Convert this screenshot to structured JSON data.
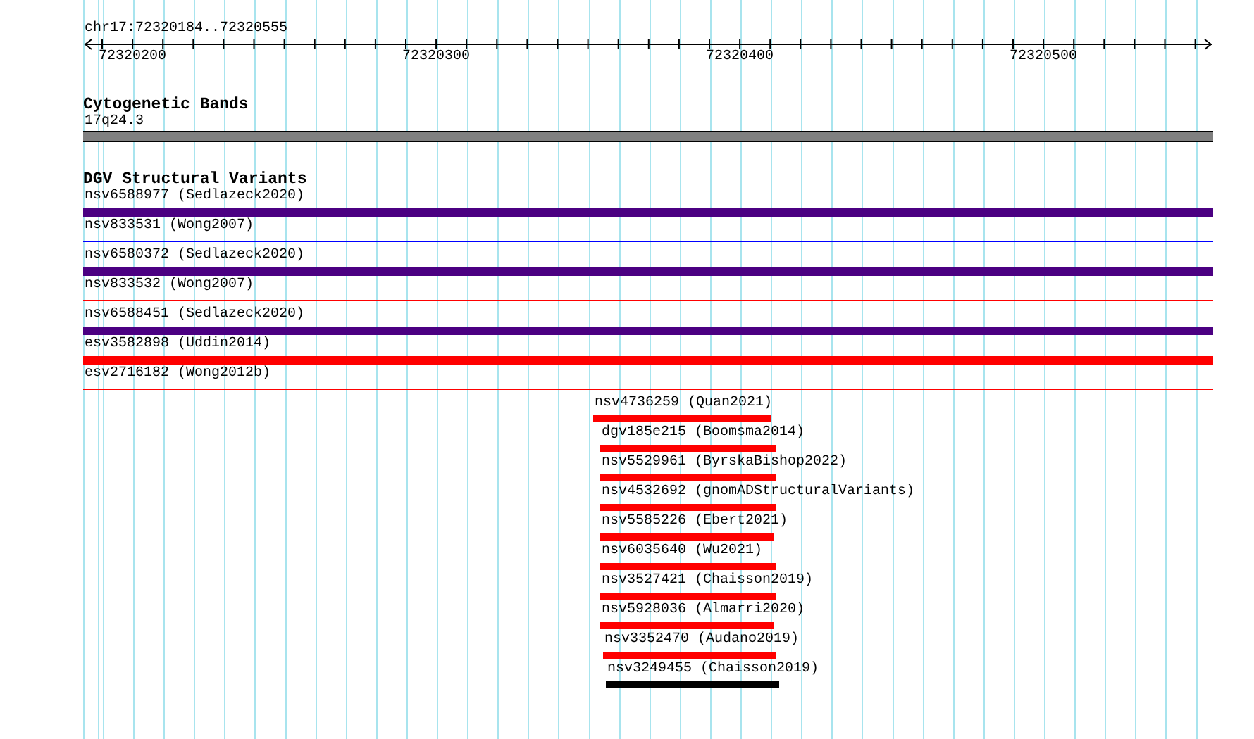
{
  "ruler": {
    "title": "chr17:72320184..72320555",
    "ticks": [
      "72320200",
      "72320300",
      "72320400",
      "72320500"
    ]
  },
  "cytogenetic_track": {
    "title": "Cytogenetic Bands",
    "band": {
      "label": "17q24.3",
      "color": "#808080"
    }
  },
  "dgv_track": {
    "title": "DGV Structural Variants",
    "variants": [
      {
        "label": "nsv6588977 (Sedlazeck2020)",
        "kind": "bar",
        "color": "#4b0082"
      },
      {
        "label": "nsv833531 (Wong2007)",
        "kind": "line",
        "color": "#0000ff"
      },
      {
        "label": "nsv6580372 (Sedlazeck2020)",
        "kind": "bar",
        "color": "#4b0082"
      },
      {
        "label": "nsv833532 (Wong2007)",
        "kind": "line",
        "color": "#ff0000"
      },
      {
        "label": "nsv6588451 (Sedlazeck2020)",
        "kind": "bar",
        "color": "#4b0082"
      },
      {
        "label": "esv3582898 (Uddin2014)",
        "kind": "bar",
        "color": "#ff0000"
      },
      {
        "label": "esv2716182 (Wong2012b)",
        "kind": "line",
        "color": "#ff0000"
      }
    ],
    "short_variants": [
      {
        "label": "nsv4736259 (Quan2021)",
        "kind": "bar",
        "color": "#ff0000"
      },
      {
        "label": "dgv185e215 (Boomsma2014)",
        "kind": "bar",
        "color": "#ff0000"
      },
      {
        "label": "nsv5529961 (ByrskaBishop2022)",
        "kind": "bar",
        "color": "#ff0000"
      },
      {
        "label": "nsv4532692 (gnomADStructuralVariants)",
        "kind": "bar",
        "color": "#ff0000"
      },
      {
        "label": "nsv5585226 (Ebert2021)",
        "kind": "bar",
        "color": "#ff0000"
      },
      {
        "label": "nsv6035640 (Wu2021)",
        "kind": "bar",
        "color": "#ff0000"
      },
      {
        "label": "nsv3527421 (Chaisson2019)",
        "kind": "bar",
        "color": "#ff0000"
      },
      {
        "label": "nsv5928036 (Almarri2020)",
        "kind": "bar",
        "color": "#ff0000"
      },
      {
        "label": "nsv3352470 (Audano2019)",
        "kind": "bar",
        "color": "#ff0000"
      },
      {
        "label": "nsv3249455 (Chaisson2019)",
        "kind": "bar",
        "color": "#000000"
      }
    ]
  }
}
